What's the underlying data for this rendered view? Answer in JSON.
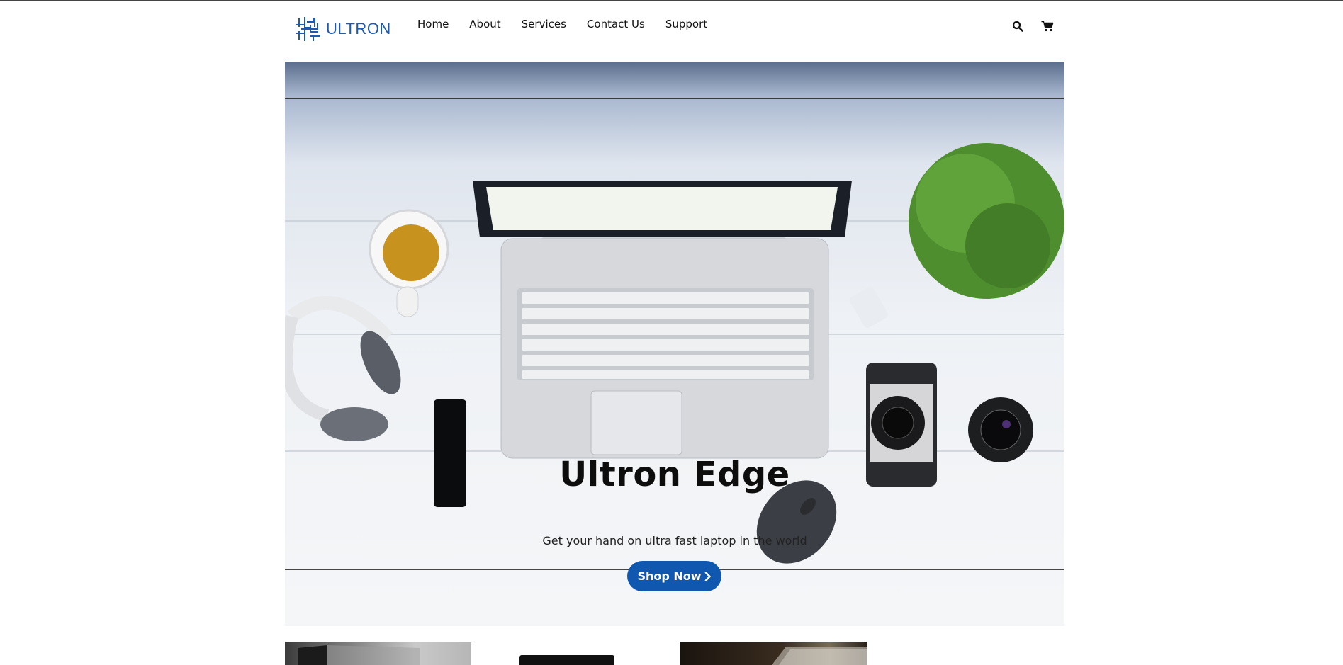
{
  "brand": {
    "name": "ULTRON",
    "color": "#1e5bb0"
  },
  "nav": {
    "items": [
      {
        "label": "Home"
      },
      {
        "label": "About"
      },
      {
        "label": "Services"
      },
      {
        "label": "Contact Us"
      },
      {
        "label": "Support"
      }
    ],
    "icons": [
      "search-icon",
      "cart-icon"
    ]
  },
  "hero": {
    "title": "Ultron Edge",
    "subtitle": "Get your hand on ultra fast laptop in the world",
    "cta_label": "Shop Now",
    "cta_color": "#1057b0"
  },
  "cards": [
    {
      "name": "product-card-1"
    },
    {
      "name": "product-card-2"
    },
    {
      "name": "product-card-3"
    }
  ]
}
